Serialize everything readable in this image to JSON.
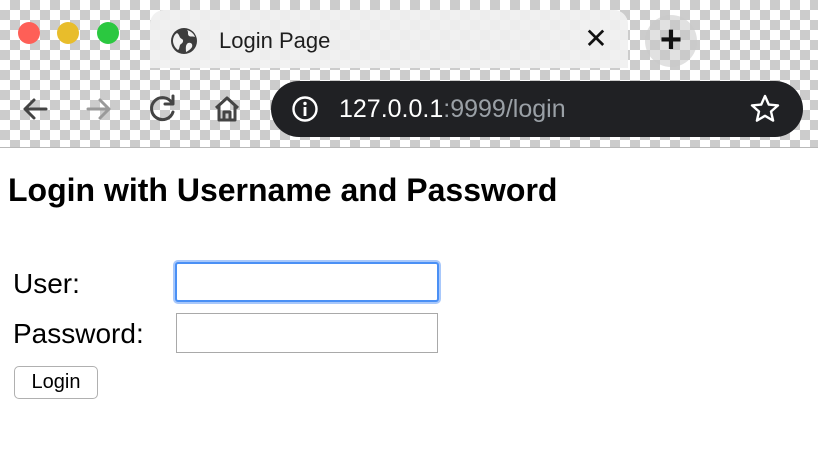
{
  "browser": {
    "tab": {
      "title": "Login Page",
      "close_glyph": "✕",
      "icon": "globe-icon"
    },
    "new_tab_glyph": "+",
    "nav": {
      "back_icon": "back-arrow-icon",
      "forward_icon": "forward-arrow-icon",
      "reload_icon": "reload-icon",
      "home_icon": "home-icon"
    },
    "address_bar": {
      "host": "127.0.0.1",
      "path": ":9999/login",
      "info_icon": "info-icon",
      "bookmark_icon": "star-icon"
    },
    "colors": {
      "omnibox_bg": "#202124",
      "focus_ring": "#4a90f5"
    }
  },
  "page": {
    "heading": "Login with Username and Password",
    "form": {
      "user_label": "User:",
      "user_value": "",
      "password_label": "Password:",
      "password_value": "",
      "submit_label": "Login"
    }
  }
}
